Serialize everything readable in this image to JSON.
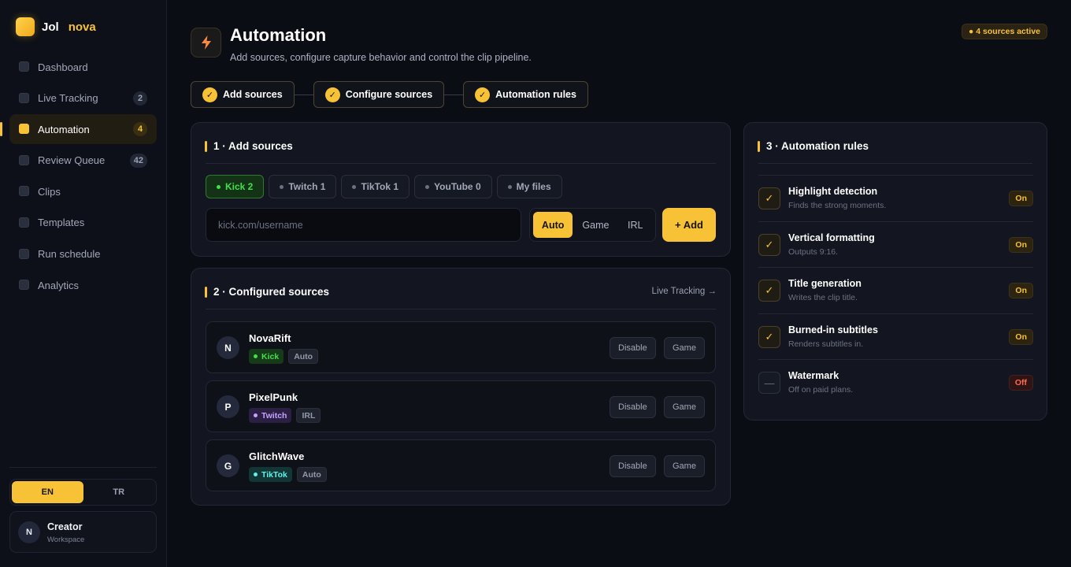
{
  "brand": {
    "name": "Jol",
    "accent": "nova",
    "accent_color": "#f7c236"
  },
  "sidebar": {
    "items": [
      {
        "label": "Dashboard",
        "badge": null
      },
      {
        "label": "Live Tracking",
        "badge": "2"
      },
      {
        "label": "Automation",
        "badge": "4"
      },
      {
        "label": "Review Queue",
        "badge": "42"
      },
      {
        "label": "Clips",
        "badge": null
      },
      {
        "label": "Templates",
        "badge": null
      },
      {
        "label": "Run schedule",
        "badge": null
      },
      {
        "label": "Analytics",
        "badge": null
      }
    ],
    "active_item": "Automation",
    "languages": [
      "EN",
      "TR"
    ],
    "active_language": "EN",
    "profile": {
      "initial": "N",
      "name": "Creator",
      "subtitle": "Workspace"
    }
  },
  "header": {
    "icon": "lightning-icon",
    "title": "Automation",
    "subtitle": "Add sources, configure capture behavior and control the clip pipeline.",
    "status": "● 4 sources active"
  },
  "steps": [
    "Add sources",
    "Configure sources",
    "Automation rules"
  ],
  "add_sources": {
    "title": "1 · Add sources",
    "tabs": [
      {
        "label": "Kick 2",
        "active": true
      },
      {
        "label": "Twitch 1",
        "active": false
      },
      {
        "label": "TikTok 1",
        "active": false
      },
      {
        "label": "YouTube 0",
        "active": false
      },
      {
        "label": "My files",
        "active": false
      }
    ],
    "input_placeholder": "kick.com/username",
    "input_value": "",
    "modes": [
      "Auto",
      "Game",
      "IRL"
    ],
    "active_mode": "Auto",
    "add_label": "+ Add"
  },
  "configured": {
    "title": "2 · Configured sources",
    "link": "Live Tracking →",
    "rows": [
      {
        "initial": "N",
        "name": "NovaRift",
        "platform": "Kick",
        "platform_color": "#3fe04a",
        "platform_bg": "#173a19",
        "mode": "Auto",
        "disable_label": "Disable",
        "mode_btn": "Game"
      },
      {
        "initial": "P",
        "name": "PixelPunk",
        "platform": "Twitch",
        "platform_color": "#c5a3ff",
        "platform_bg": "#2b1f44",
        "mode": "IRL",
        "disable_label": "Disable",
        "mode_btn": "Game"
      },
      {
        "initial": "G",
        "name": "GlitchWave",
        "platform": "TikTok",
        "platform_color": "#5ff3ea",
        "platform_bg": "#123535",
        "mode": "Auto",
        "disable_label": "Disable",
        "mode_btn": "Game"
      }
    ]
  },
  "rules": {
    "title": "3 · Automation rules",
    "items": [
      {
        "title": "Highlight detection",
        "desc": "Finds the strong moments.",
        "state": "On",
        "enabled": true
      },
      {
        "title": "Vertical formatting",
        "desc": "Outputs 9:16.",
        "state": "On",
        "enabled": true
      },
      {
        "title": "Title generation",
        "desc": "Writes the clip title.",
        "state": "On",
        "enabled": true
      },
      {
        "title": "Burned-in subtitles",
        "desc": "Renders subtitles in.",
        "state": "On",
        "enabled": true
      },
      {
        "title": "Watermark",
        "desc": "Off on paid plans.",
        "state": "Off",
        "enabled": false
      }
    ]
  }
}
